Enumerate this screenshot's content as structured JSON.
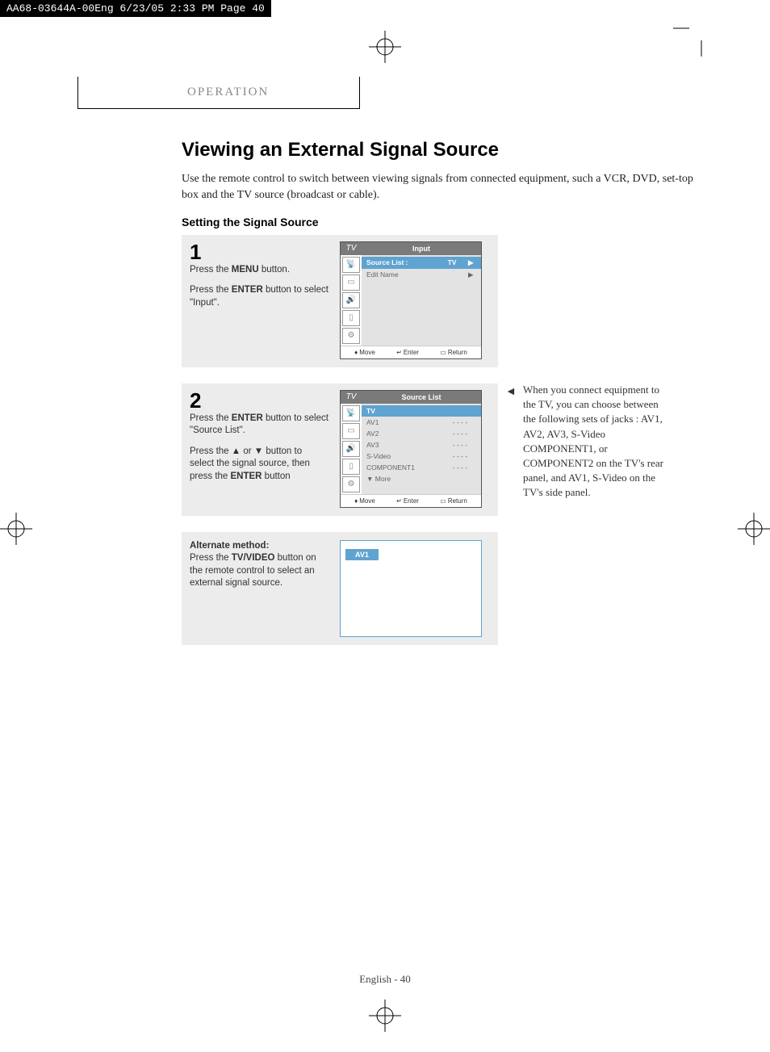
{
  "header_strip": "AA68-03644A-00Eng  6/23/05  2:33 PM  Page 40",
  "section_label": "OPERATION",
  "title": "Viewing an External Signal Source",
  "intro": "Use the remote control to switch between viewing signals from connected equipment, such a VCR, DVD, set-top box and the TV source (broadcast or cable).",
  "subheading": "Setting the Signal Source",
  "step1": {
    "num": "1",
    "line1a": "Press the ",
    "line1b": "MENU",
    "line1c": " button.",
    "line2a": "Press the ",
    "line2b": "ENTER",
    "line2c": " button to select \"Input\"."
  },
  "menu1": {
    "tab": "TV",
    "title": "Input",
    "row1_label": "Source List :",
    "row1_val": "TV",
    "row1_arrow": "▶",
    "row2_label": "Edit Name",
    "row2_arrow": "▶",
    "footer_move": "Move",
    "footer_enter": "Enter",
    "footer_return": "Return"
  },
  "step2": {
    "num": "2",
    "line1a": "Press the ",
    "line1b": "ENTER",
    "line1c": " button to select \"Source List\".",
    "line2a": "Press the ▲ or ▼ button to select the signal source, then press the ",
    "line2b": "ENTER",
    "line2c": " button"
  },
  "menu2": {
    "tab": "TV",
    "title": "Source List",
    "rows": [
      {
        "label": "TV",
        "val": "",
        "sel": true
      },
      {
        "label": "AV1",
        "val": "- - - -"
      },
      {
        "label": "AV2",
        "val": "- - - -"
      },
      {
        "label": "AV3",
        "val": "- - - -"
      },
      {
        "label": "S-Video",
        "val": "- - - -"
      },
      {
        "label": "COMPONENT1",
        "val": "- - - -"
      },
      {
        "label": "▼ More",
        "val": ""
      }
    ],
    "footer_move": "Move",
    "footer_enter": "Enter",
    "footer_return": "Return"
  },
  "alt": {
    "heading": "Alternate method:",
    "line1a": "Press the ",
    "line1b": "TV/VIDEO",
    "line1c": " button on the remote control to select an external signal source.",
    "badge": "AV1"
  },
  "sidenote": {
    "caret": "◄",
    "text": "When you connect equipment to the TV, you can choose between the following sets of jacks : AV1, AV2, AV3,  S-Video COMPONENT1, or COMPONENT2 on the TV's rear panel, and AV1, S-Video on the TV's side panel."
  },
  "footer": "English - 40"
}
